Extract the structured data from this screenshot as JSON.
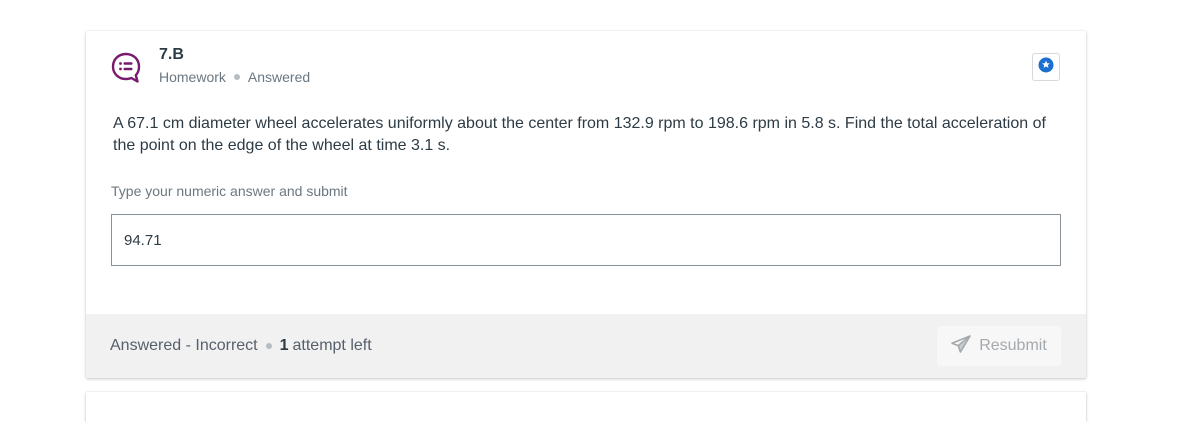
{
  "question": {
    "number": "7.B",
    "type": "Homework",
    "state": "Answered",
    "text": "A 67.1 cm diameter wheel accelerates uniformly about the center from 132.9 rpm to 198.6 rpm in 5.8 s. Find the total acceleration of the point on the edge of the wheel at time 3.1 s."
  },
  "answer": {
    "label": "Type your numeric answer and submit",
    "value": "94.71"
  },
  "footer": {
    "status": "Answered - Incorrect",
    "attempts_count": "1",
    "attempts_suffix": "attempt left",
    "resubmit_label": "Resubmit"
  },
  "icons": {
    "question": "question-chat-icon",
    "bookmark": "star-badge-icon",
    "resubmit": "send-icon"
  },
  "colors": {
    "icon_purple": "#7a1a6e",
    "bookmark_blue": "#1c6fcf",
    "footer_bg": "#f1f1f2",
    "disabled_text": "#a4a9ae"
  }
}
